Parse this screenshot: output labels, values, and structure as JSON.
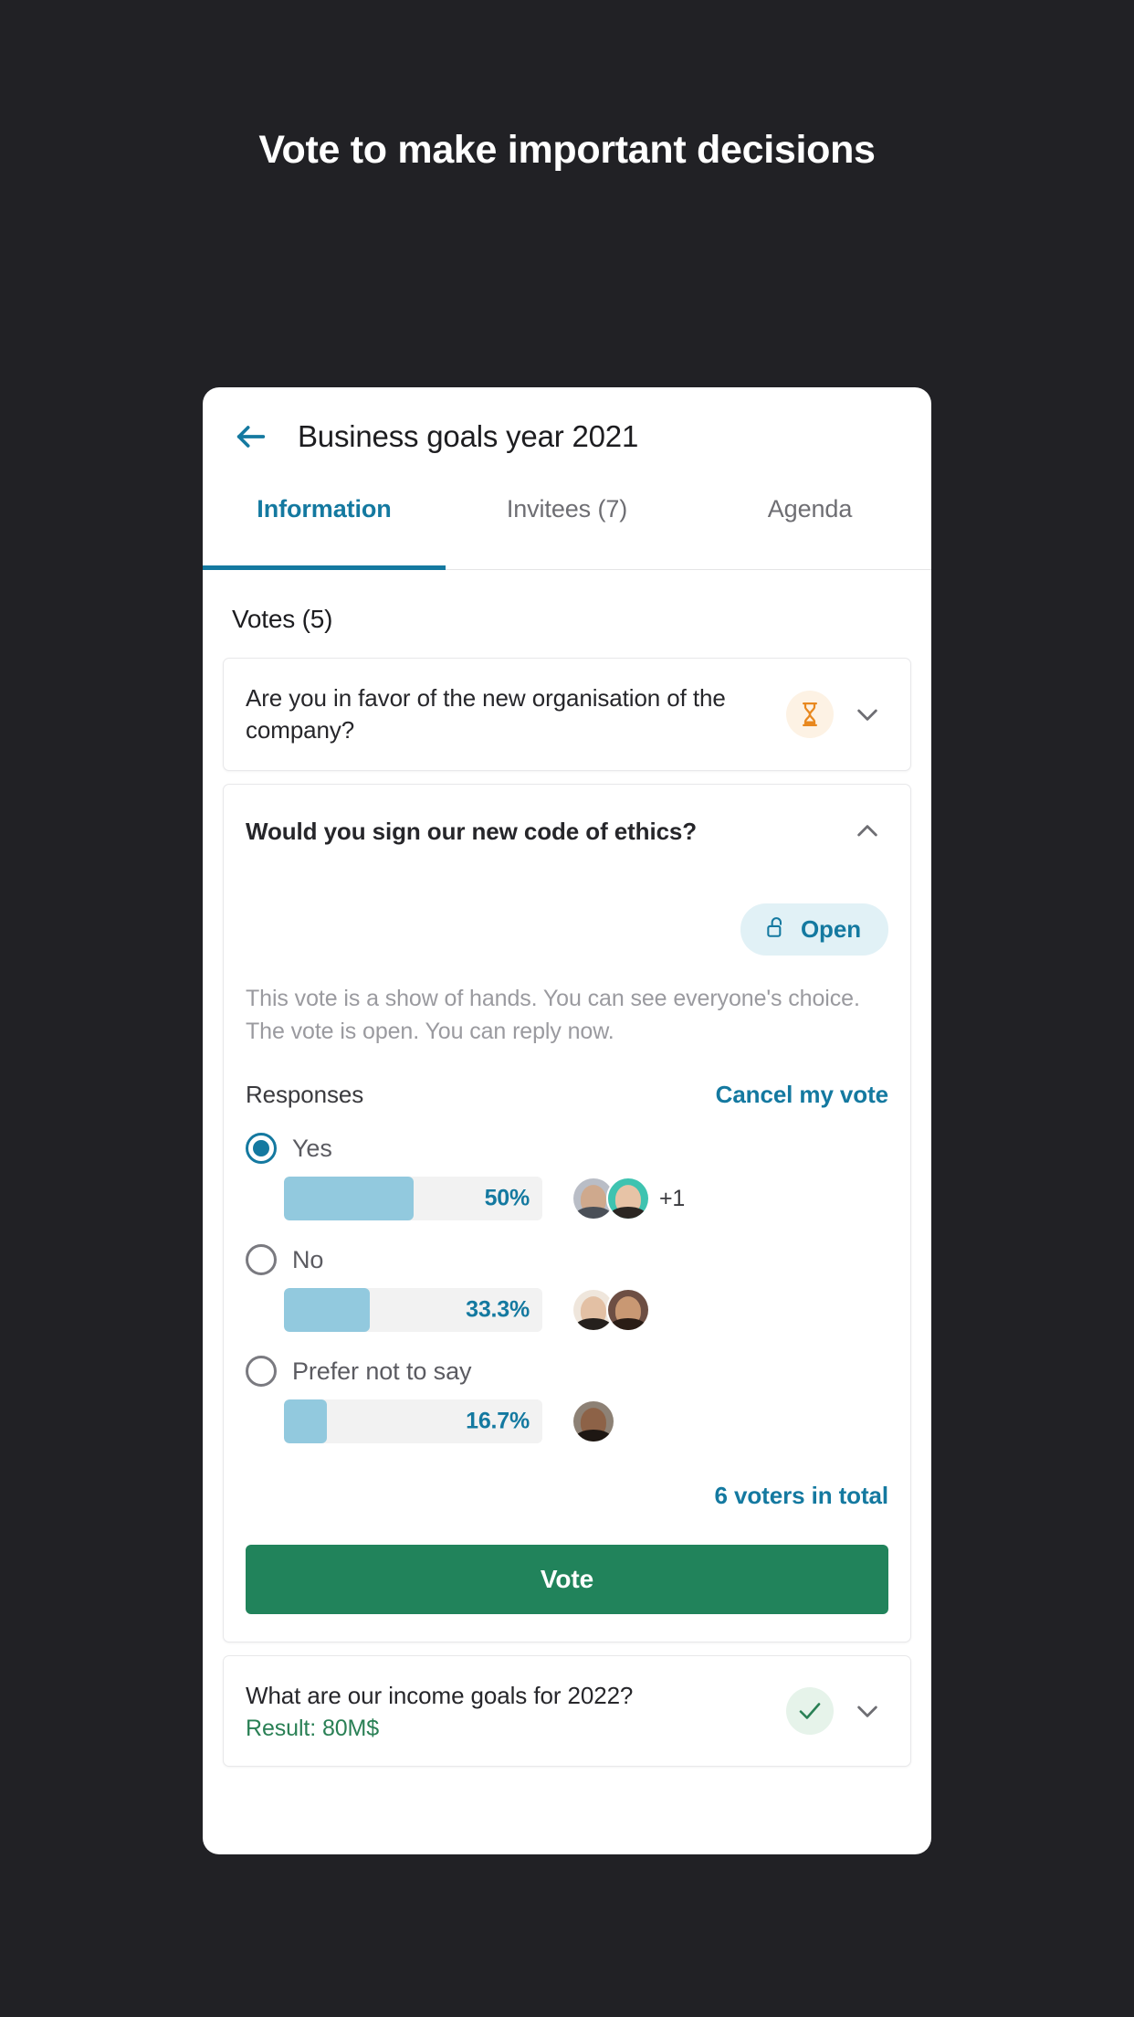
{
  "headline": "Vote to make important decisions",
  "colors": {
    "page_background": "#212125",
    "accent": "#1479a0",
    "bar_fill": "#92c9de",
    "bar_track": "#f2f2f2",
    "vote_button": "#21835b",
    "result_green": "#2a8055",
    "pending_orange": "#e8881f"
  },
  "appbar": {
    "back_icon": "arrow-left-icon",
    "title": "Business goals year 2021"
  },
  "tabs": [
    {
      "label": "Information",
      "active": true
    },
    {
      "label": "Invitees (7)",
      "active": false
    },
    {
      "label": "Agenda",
      "active": false
    }
  ],
  "votes_section": {
    "title": "Votes (5)"
  },
  "vote_items": [
    {
      "question": "Are you in favor of the new organisation of the company?",
      "status_icon": "hourglass-icon",
      "chevron": "chevron-down-icon",
      "expanded": false
    },
    {
      "question": "Would you sign our new code of ethics?",
      "chevron": "chevron-up-icon",
      "expanded": true,
      "status_badge": {
        "icon": "unlock-icon",
        "label": "Open"
      },
      "description_line1": "This vote is a show of hands. You can see everyone's choice.",
      "description_line2": "The vote is open. You can reply now.",
      "responses_label": "Responses",
      "cancel_link": "Cancel my vote",
      "options": [
        {
          "label": "Yes",
          "selected": true,
          "percent_label": "50%",
          "percent_value": 50,
          "avatars": [
            "f-a",
            "f-b"
          ],
          "extra": "+1"
        },
        {
          "label": "No",
          "selected": false,
          "percent_label": "33.3%",
          "percent_value": 33.3,
          "avatars": [
            "f-c",
            "f-d"
          ],
          "extra": ""
        },
        {
          "label": "Prefer not to say",
          "selected": false,
          "percent_label": "16.7%",
          "percent_value": 16.7,
          "avatars": [
            "f-e"
          ],
          "extra": ""
        }
      ],
      "voters_total": "6 voters in total",
      "vote_button": "Vote"
    },
    {
      "question": "What are our income goals for 2022?",
      "result": "Result: 80M$",
      "status_icon": "check-icon",
      "chevron": "chevron-down-icon",
      "expanded": false
    }
  ]
}
